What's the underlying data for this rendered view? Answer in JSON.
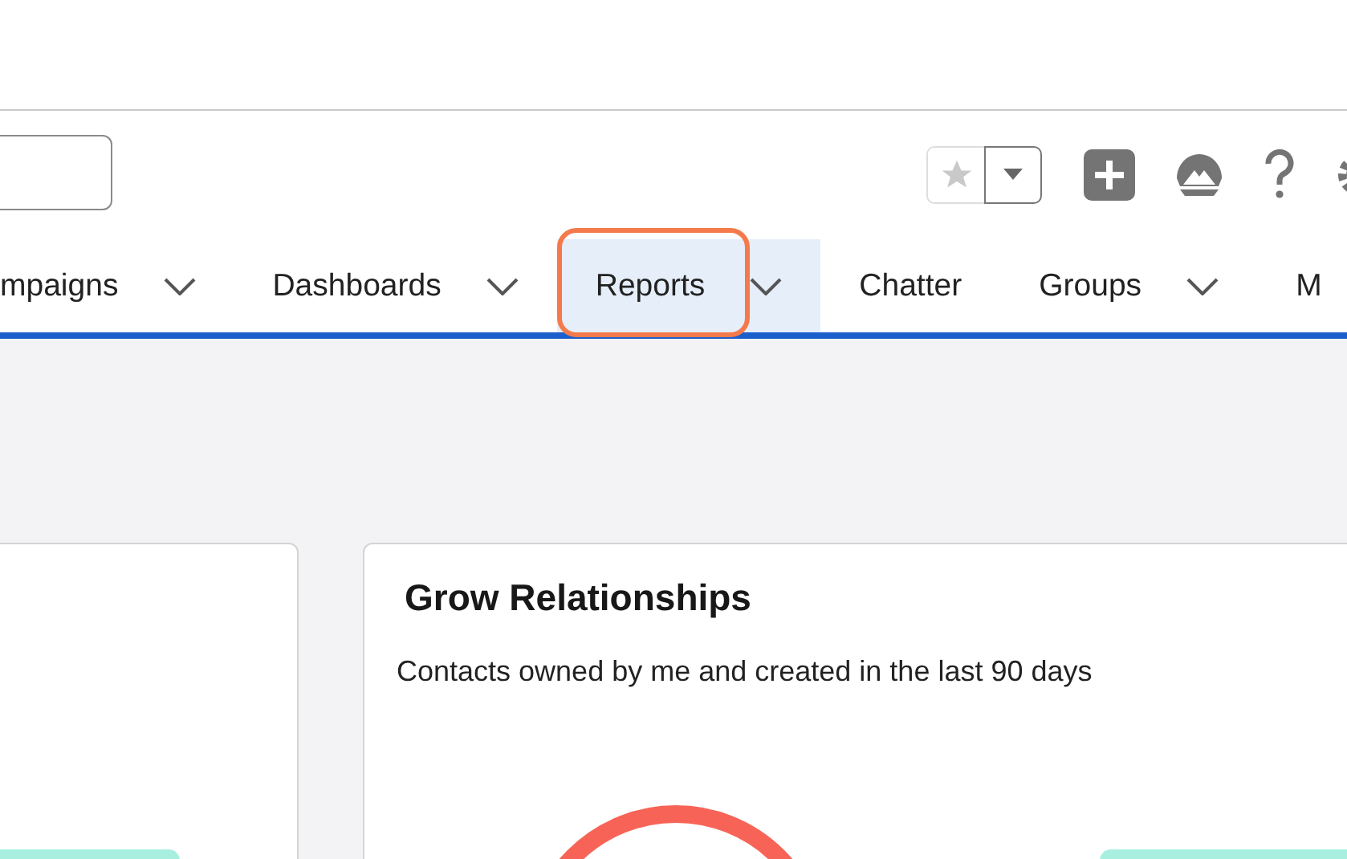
{
  "header": {
    "favorites": {
      "starred": false
    }
  },
  "nav": {
    "tabs": [
      {
        "label": "mpaigns",
        "has_menu": true,
        "selected": false,
        "highlighted": false
      },
      {
        "label": "Dashboards",
        "has_menu": true,
        "selected": false,
        "highlighted": false
      },
      {
        "label": "Reports",
        "has_menu": true,
        "selected": true,
        "highlighted": true
      },
      {
        "label": "Chatter",
        "has_menu": false,
        "selected": false,
        "highlighted": false
      },
      {
        "label": "Groups",
        "has_menu": true,
        "selected": false,
        "highlighted": false
      },
      {
        "label": "M",
        "has_menu": false,
        "selected": false,
        "highlighted": false
      }
    ]
  },
  "cards": [
    {
      "kind": "partial"
    },
    {
      "kind": "chart",
      "title": "Grow Relationships",
      "subtitle": "Contacts owned by me and created in the last 90 days"
    }
  ]
}
